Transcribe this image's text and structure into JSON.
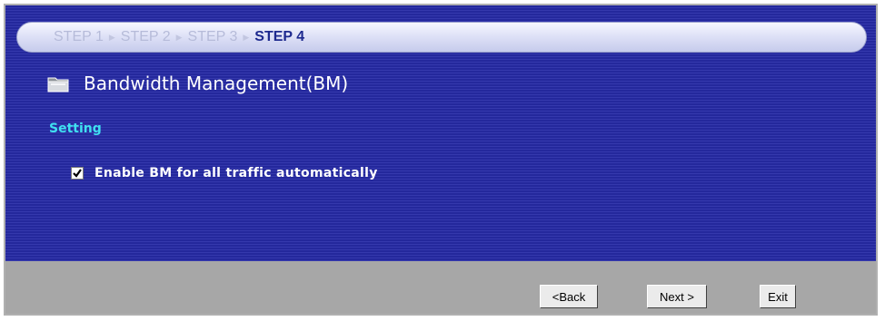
{
  "steps": [
    {
      "label": "STEP 1",
      "active": false
    },
    {
      "label": "STEP 2",
      "active": false
    },
    {
      "label": "STEP 3",
      "active": false
    },
    {
      "label": "STEP 4",
      "active": true
    }
  ],
  "title": "Bandwidth Management(BM)",
  "title_icon": "folder-icon",
  "section": "Setting",
  "checkbox": {
    "label": "Enable BM for all traffic automatically",
    "checked": true
  },
  "buttons": {
    "back": "<Back",
    "next": "Next >",
    "exit": "Exit"
  },
  "colors": {
    "panel": "#24289c",
    "section_label": "#3fe0f0",
    "footer": "#a7a7a7"
  }
}
